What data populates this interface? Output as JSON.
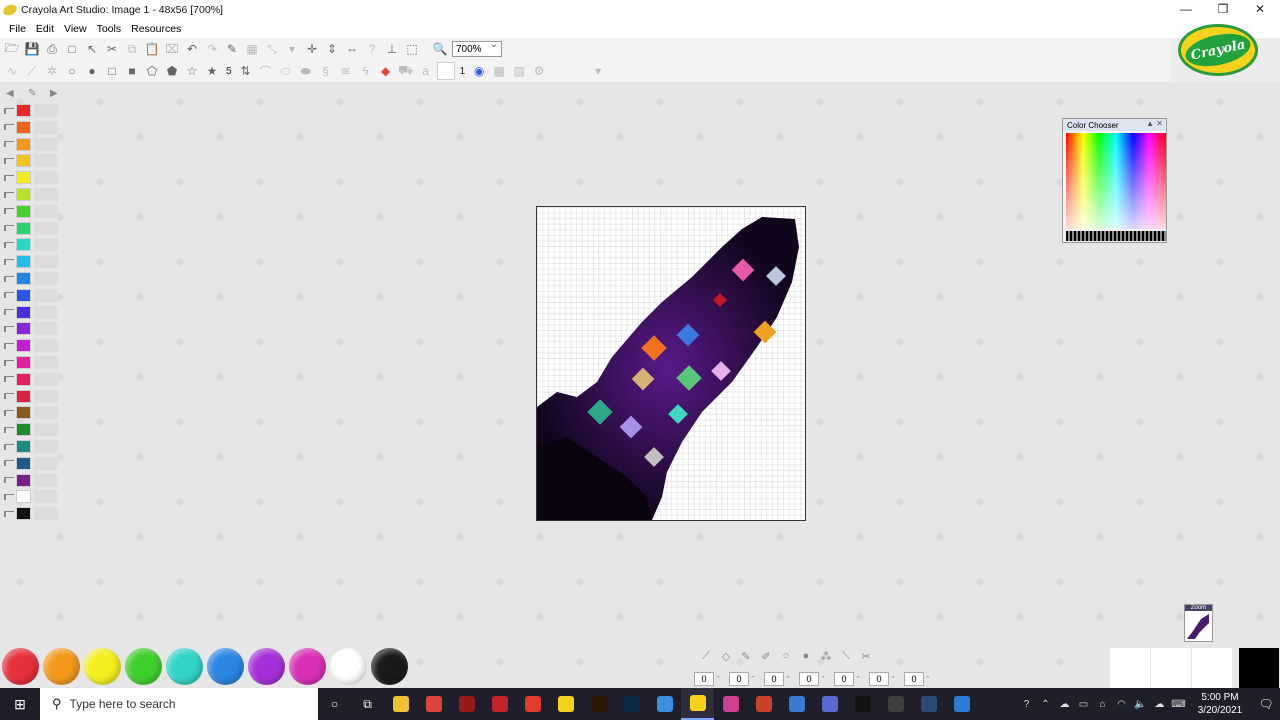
{
  "window": {
    "title": "Crayola Art Studio: Image 1 - 48x56 [700%]",
    "minimize": "—",
    "maximize": "❐",
    "close": "✕"
  },
  "menu": [
    "File",
    "Edit",
    "View",
    "Tools",
    "Resources"
  ],
  "toolbar": {
    "zoom_value": "700%",
    "brush_size": "5",
    "line_width": "1"
  },
  "logo": {
    "text": "Crayola"
  },
  "color_chooser": {
    "title": "Color Chooser",
    "collapse": "▲",
    "close": "✕"
  },
  "thumbnail": {
    "label": "Zoom"
  },
  "left_palette_colors": [
    "#e8282b",
    "#f0611b",
    "#f39a1e",
    "#f6c21f",
    "#f4ea20",
    "#b6e326",
    "#45d12c",
    "#28d36e",
    "#27d9c5",
    "#22bde8",
    "#1f86e3",
    "#2a56e3",
    "#4a30d9",
    "#8a26d6",
    "#c21fd3",
    "#e21fa3",
    "#e51f63",
    "#d92040",
    "#8a5a1a",
    "#1f8a2c",
    "#1f8a80",
    "#1f5a8a",
    "#7a1f8a",
    "#ffffff",
    "#111111"
  ],
  "crayons": [
    "#e8303c",
    "#f39a1e",
    "#f5ee1f",
    "#3fcf2c",
    "#32d4c8",
    "#2a86e3",
    "#a530d9",
    "#d930b5",
    "#ffffff",
    "#1a1a1a"
  ],
  "coords": [
    "0",
    "0",
    "0",
    "0",
    "0",
    "0",
    "0"
  ],
  "taskbar": {
    "start": "⊞",
    "search_placeholder": "Type here to search",
    "time": "5:00 PM",
    "date": "3/20/2021",
    "apps": [
      {
        "name": "cortana-icon",
        "color": "transparent",
        "glyph": "○"
      },
      {
        "name": "task-view-icon",
        "color": "transparent",
        "glyph": "⧉"
      },
      {
        "name": "file-explorer-icon",
        "color": "#f2c231",
        "glyph": ""
      },
      {
        "name": "chrome-icon",
        "color": "#db4437",
        "glyph": ""
      },
      {
        "name": "animate-icon",
        "color": "#9a1a1a",
        "glyph": ""
      },
      {
        "name": "flash-icon",
        "color": "#c4242a",
        "glyph": ""
      },
      {
        "name": "acrobat-icon",
        "color": "#e03c2e",
        "glyph": ""
      },
      {
        "name": "norton-icon",
        "color": "#f6d21d",
        "glyph": ""
      },
      {
        "name": "illustrator-icon",
        "color": "#2a1b05",
        "glyph": ""
      },
      {
        "name": "photoshop-icon",
        "color": "#0a2a45",
        "glyph": ""
      },
      {
        "name": "settings-app-icon",
        "color": "#3b8fe0",
        "glyph": ""
      },
      {
        "name": "crayola-taskbar-icon",
        "color": "#f6d21d",
        "glyph": ""
      },
      {
        "name": "app-swirl-icon",
        "color": "#d04090",
        "glyph": ""
      },
      {
        "name": "powerpoint-icon",
        "color": "#c8412a",
        "glyph": ""
      },
      {
        "name": "paint-icon",
        "color": "#3a7ad0",
        "glyph": ""
      },
      {
        "name": "calculator-icon",
        "color": "#5a6ad0",
        "glyph": ""
      },
      {
        "name": "terminal-icon",
        "color": "#111111",
        "glyph": ""
      },
      {
        "name": "chart-app-icon",
        "color": "#404040",
        "glyph": ""
      },
      {
        "name": "monitor-app-icon",
        "color": "#2a4a7a",
        "glyph": ""
      },
      {
        "name": "edge-icon",
        "color": "#2b7dd6",
        "glyph": ""
      }
    ]
  }
}
